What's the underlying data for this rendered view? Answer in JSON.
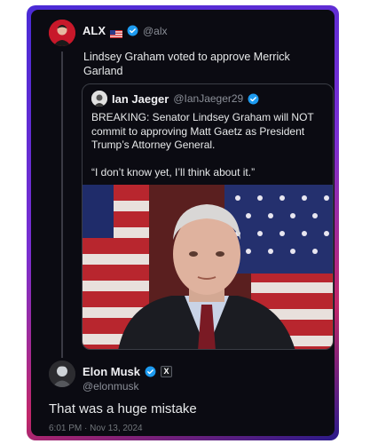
{
  "colors": {
    "card_bg": "#0b0b12",
    "verified_blue": "#1d9bf0",
    "text_primary": "#e7e9ea",
    "text_secondary": "#8b8f98"
  },
  "main_post": {
    "author_name": "ALX",
    "flag_icon": "us-flag-icon",
    "verified_icon": "verified-badge-icon",
    "handle": "@alx",
    "text": "Lindsey Graham voted to approve Merrick Garland"
  },
  "quoted_post": {
    "author_name": "Ian Jaeger",
    "verified_icon": "verified-badge-icon",
    "handle": "@IanJaeger29",
    "text_1": "BREAKING: Senator Lindsey Graham will NOT commit to approving Matt Gaetz as President Trump’s Attorney General.",
    "text_2": "“I don’t know yet, I’ll think about it.”",
    "image": "photo-senator-with-american-flags"
  },
  "reply": {
    "author_name": "Elon Musk",
    "verified_icon": "verified-badge-icon",
    "x_badge_label": "X",
    "handle": "@elonmusk",
    "text": "That was a huge mistake",
    "timestamp": "6:01 PM · Nov 13, 2024"
  }
}
